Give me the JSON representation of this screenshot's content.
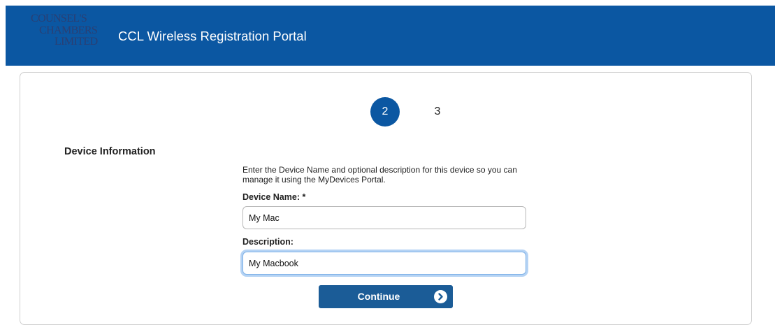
{
  "header": {
    "logo_lines": [
      "COUNSEL'S",
      "CHAMBERS",
      "LIMITED"
    ],
    "title": "CCL Wireless Registration Portal"
  },
  "steps": {
    "current": "2",
    "next": "3"
  },
  "section": {
    "title": "Device Information",
    "intro": "Enter the Device Name and optional description for this device so you can manage it using the MyDevices Portal."
  },
  "form": {
    "device_name_label": "Device Name: *",
    "device_name_value": "My Mac",
    "description_label": "Description:",
    "description_value": "My Macbook",
    "continue_label": "Continue"
  },
  "icons": {
    "continue_arrow": "chevron-right-icon"
  },
  "colors": {
    "brand_blue": "#0b57a2",
    "button_blue": "#1b5c97",
    "logo_text": "#2a3f73",
    "focus_ring": "#7fb2e8"
  }
}
